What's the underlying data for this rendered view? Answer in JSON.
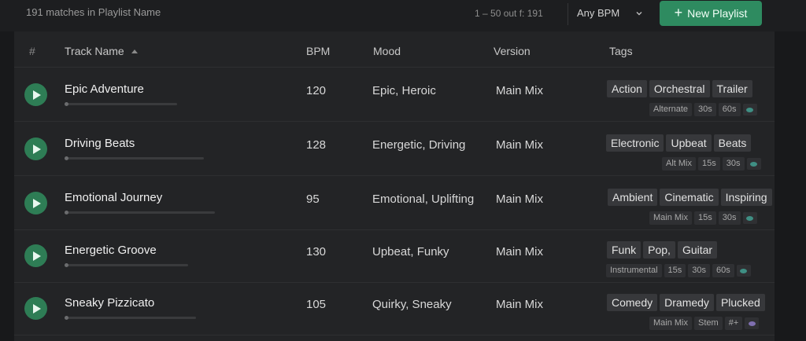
{
  "toolbar": {
    "match_text": "191 matches in Playlist Name",
    "range_text": "1 – 50 out f: 191",
    "bpm_filter": "Any BPM",
    "new_playlist_label": "New Playlist"
  },
  "columns": {
    "hash": "#",
    "track_name": "Track Name",
    "bpm": "BPM",
    "mood": "Mood",
    "version": "Version",
    "tags": "Tags"
  },
  "colors": {
    "accent": "#2e8b60",
    "play": "#2e7d55",
    "eye_teal": "#3f8f84",
    "eye_purple": "#7f6fb0"
  },
  "rows": [
    {
      "name": "Epic Adventure",
      "bpm": "120",
      "mood": "Epic, Heroic",
      "version": "Main Mix",
      "tags": [
        "Action",
        "Orchestral",
        "Trailer"
      ],
      "subtags": [
        "Alternate",
        "30s",
        "60s"
      ],
      "eye": "teal"
    },
    {
      "name": "Driving Beats",
      "bpm": "128",
      "mood": "Energetic, Driving",
      "version": "Main Mix",
      "tags": [
        "Electronic",
        "Upbeat",
        "Beats"
      ],
      "subtags": [
        "Alt Mix",
        "15s",
        "30s"
      ],
      "eye": "teal"
    },
    {
      "name": "Emotional Journey",
      "bpm": "95",
      "mood": "Emotional, Uplifting",
      "version": "Main Mix",
      "tags": [
        "Ambient",
        "Cinematic",
        "Inspiring"
      ],
      "subtags": [
        "Main Mix",
        "15s",
        "30s"
      ],
      "eye": "teal"
    },
    {
      "name": "Energetic Groove",
      "bpm": "130",
      "mood": "Upbeat, Funky",
      "version": "Main Mix",
      "tags": [
        "Funk",
        "Pop,",
        "Guitar"
      ],
      "subtags": [
        "Instrumental",
        "15s",
        "30s",
        "60s"
      ],
      "eye": "teal"
    },
    {
      "name": "Sneaky Pizzicato",
      "bpm": "105",
      "mood": "Quirky, Sneaky",
      "version": "Main Mix",
      "tags": [
        "Comedy",
        "Dramedy",
        "Plucked"
      ],
      "subtags": [
        "Main Mix",
        "Stem",
        "#+"
      ],
      "eye": "purple"
    }
  ]
}
